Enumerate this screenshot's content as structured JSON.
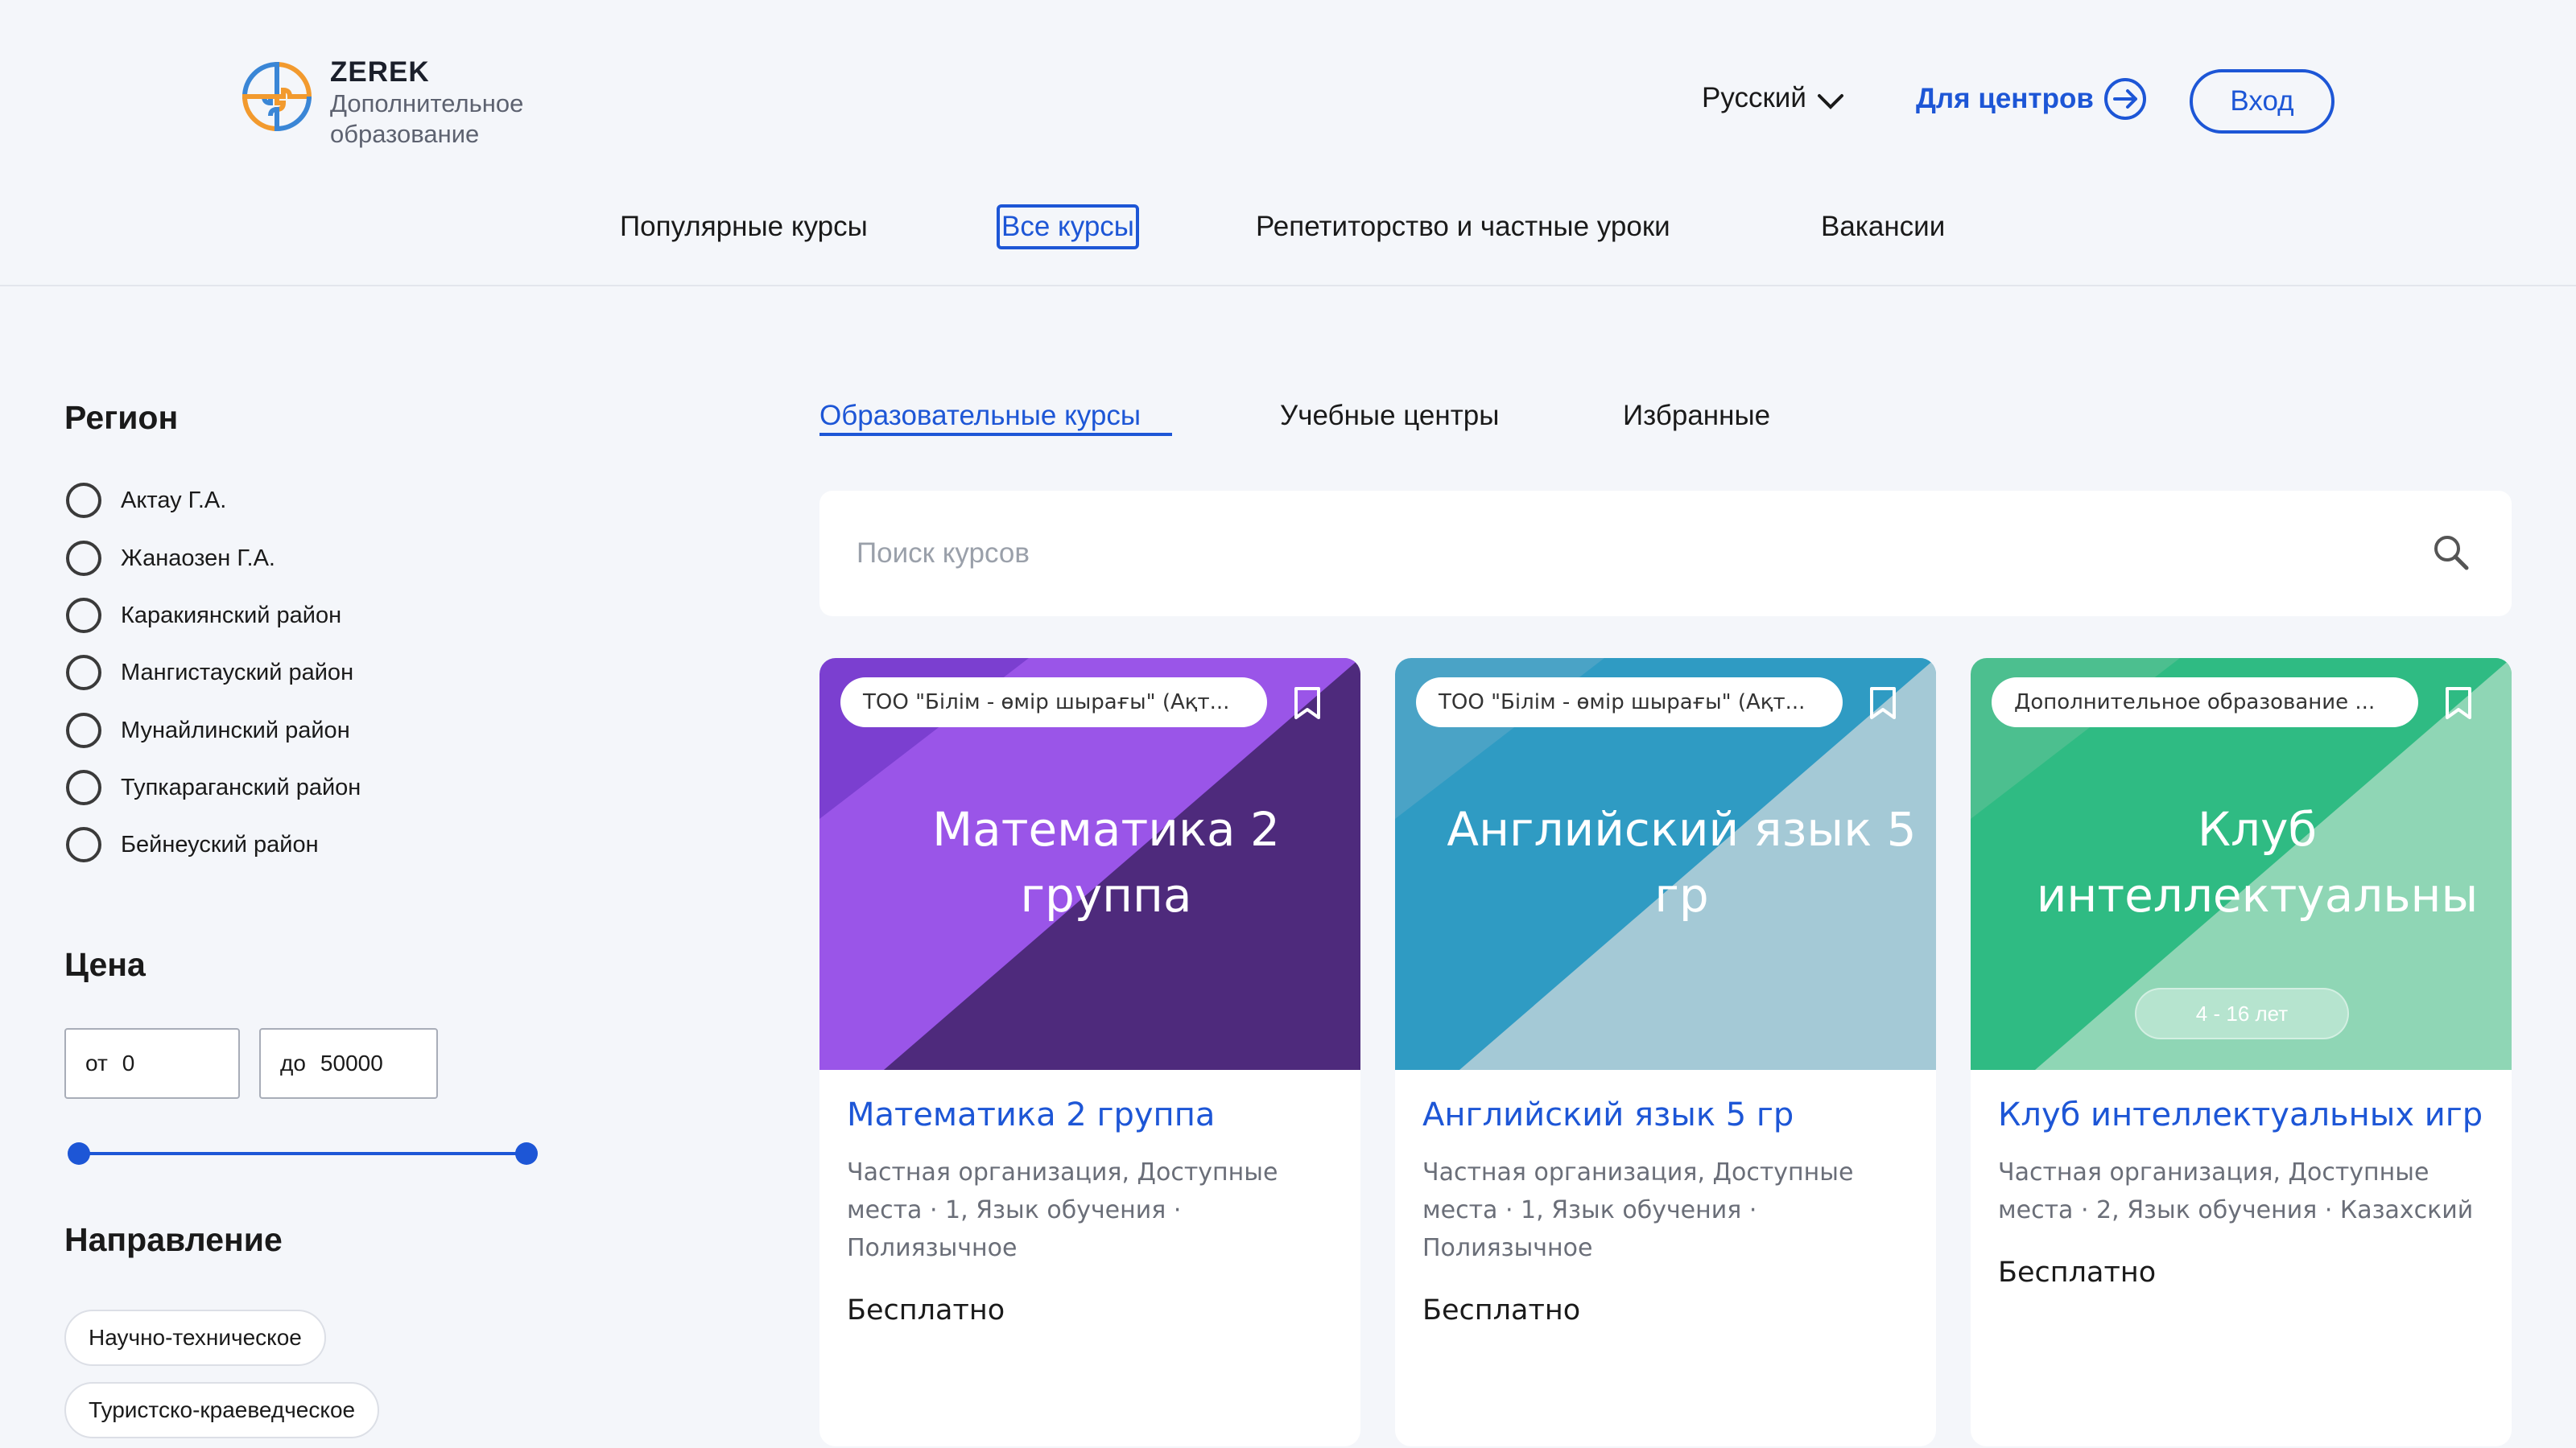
{
  "brand": {
    "name": "ZEREK",
    "subtitle": "Дополнительное образование"
  },
  "header": {
    "language": "Русский",
    "centers_link": "Для центров",
    "login_button": "Вход"
  },
  "nav": {
    "items": [
      {
        "label": "Популярные курсы",
        "active": false
      },
      {
        "label": "Все курсы",
        "active": true
      },
      {
        "label": "Репетиторство и частные уроки",
        "active": false
      },
      {
        "label": "Вакансии",
        "active": false
      }
    ]
  },
  "filters": {
    "region_title": "Регион",
    "regions": [
      "Актау Г.А.",
      "Жанаозен Г.А.",
      "Каракиянский район",
      "Мангистауский район",
      "Мунайлинский район",
      "Тупкараганский район",
      "Бейнеуский район"
    ],
    "price_title": "Цена",
    "price_from_prefix": "от",
    "price_from": "0",
    "price_to_prefix": "до",
    "price_to": "50000",
    "direction_title": "Направление",
    "directions": [
      "Научно-техническое",
      "Туристско-краеведческое"
    ]
  },
  "tabs": [
    {
      "label": "Образовательные курсы",
      "active": true
    },
    {
      "label": "Учебные центры",
      "active": false
    },
    {
      "label": "Избранные",
      "active": false
    }
  ],
  "search": {
    "placeholder": "Поиск курсов",
    "value": ""
  },
  "cards": [
    {
      "org": "ТОО \"Білім - өмір шырағы\" (Ақт...",
      "cover_title": "Математика 2\nгруппа",
      "title": "Математика 2 группа",
      "meta": "Частная организация, Доступные места · 1, Язык обучения · Полиязычное",
      "price": "Бесплатно",
      "age": "",
      "colors": {
        "base": "#7b3fd0",
        "light": "#9a55e8",
        "dark": "#4e2a7c"
      }
    },
    {
      "org": "ТОО \"Білім - өмір шырағы\" (Ақт...",
      "cover_title": "Английский язык 5\nгр",
      "title": "Английский язык 5 гр",
      "meta": "Частная организация, Доступные места · 1, Язык обучения · Полиязычное",
      "price": "Бесплатно",
      "age": "",
      "colors": {
        "base": "#4aa3c6",
        "light": "#2f9bc3",
        "dark": "#a4c9d6"
      }
    },
    {
      "org": "Дополнительное образование ...",
      "cover_title": "Клуб\nинтеллектуальны",
      "title": "Клуб интеллектуальных игр",
      "meta": "Частная организация, Доступные места · 2, Язык обучения · Казахский",
      "price": "Бесплатно",
      "age": "4 - 16 лет",
      "colors": {
        "base": "#4cbf8f",
        "light": "#2fbb83",
        "dark": "#8fd6b5"
      }
    }
  ],
  "accent": "#1d56d6"
}
